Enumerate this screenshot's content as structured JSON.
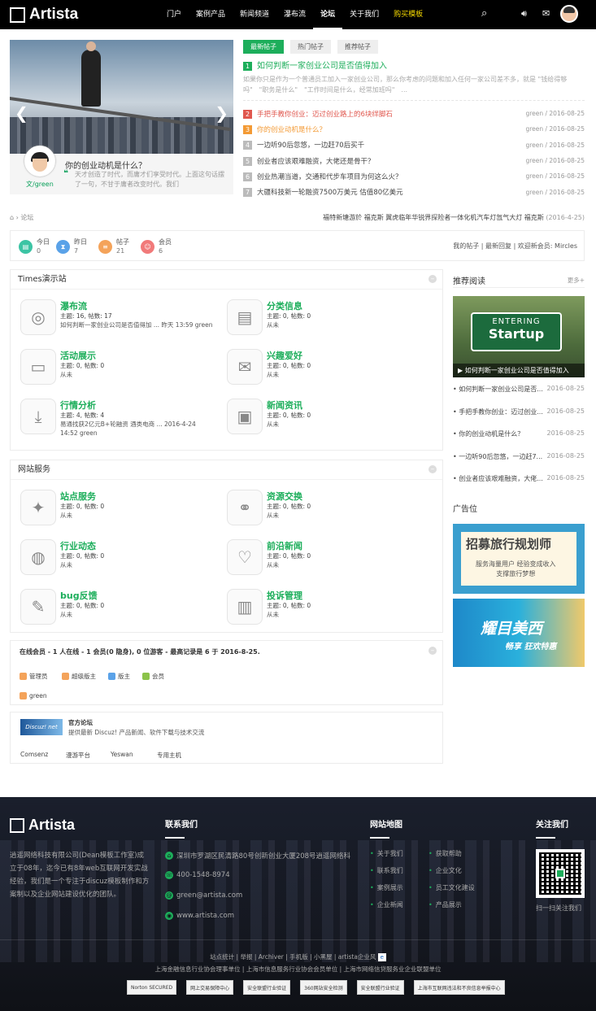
{
  "header": {
    "logo": "Artista",
    "nav": [
      "门户",
      "案例产品",
      "新闻频道",
      "瀑布流",
      "论坛",
      "关于我们",
      "购买模板"
    ],
    "active_nav": "论坛"
  },
  "slider": {
    "title": "你的创业动机是什么？",
    "text": "天才创造了时代，而庸才们享受时代。上面这句话摆了一句，不甘于庸者改变时代。我们",
    "author": "文/green"
  },
  "tabs": [
    "最新帖子",
    "热门帖子",
    "推荐帖子"
  ],
  "featured": {
    "num": "1",
    "title": "如何判断一家创业公司是否值得加入",
    "desc": "如果你只是作为一个普通员工加入一家创业公司，那么你考虑的问题和加入任何一家公司差不多，就是 \"钱给得够吗\"　\"职务是什么\"　\"工作时间是什么，经常加班吗\"　..."
  },
  "posts": [
    {
      "num": "2",
      "title": "手把手教你创业：迈过创业路上的6块绊脚石",
      "meta": "green / 2016-08-25",
      "color": "#e0574e"
    },
    {
      "num": "3",
      "title": "你的创业动机是什么？",
      "meta": "green / 2016-08-25",
      "color": "#f39a35"
    },
    {
      "num": "4",
      "title": "一边听90后忽悠，一边赶70后买千",
      "meta": "green / 2016-08-25",
      "color": "#bbbbbb"
    },
    {
      "num": "5",
      "title": "创业者应该艰难融资，大佬还是骨干？",
      "meta": "green / 2016-08-25",
      "color": "#bbbbbb"
    },
    {
      "num": "6",
      "title": "创业热潮当道，交通和代步车项目为何这么火？",
      "meta": "green / 2016-08-25",
      "color": "#bbbbbb"
    },
    {
      "num": "7",
      "title": "大疆科技新一轮融资7500万美元 估值80亿美元",
      "meta": "green / 2016-08-25",
      "color": "#bbbbbb"
    }
  ],
  "breadcrumb": {
    "home": "论坛",
    "notice": "福特新塘游於 福克斯 翼虎临年华锐界探险者一体化机汽车灯氙气大灯 福克斯",
    "date": "(2016-4-25)"
  },
  "stats": [
    {
      "label": "今日",
      "value": "0",
      "color": "#3cc4a4",
      "icon": "▤"
    },
    {
      "label": "昨日",
      "value": "7",
      "color": "#5aa2e8",
      "icon": "⧗"
    },
    {
      "label": "帖子",
      "value": "21",
      "color": "#f4a35a",
      "icon": "≡"
    },
    {
      "label": "会员",
      "value": "6",
      "color": "#f17a7a",
      "icon": "☺"
    }
  ],
  "stats_right": "我的帖子 | 最新回复 | 欢迎新会员: Mircles",
  "section1": {
    "title": "Times演示站",
    "forums": [
      {
        "name": "瀑布流",
        "stat": "主题: 16, 帖数: 17",
        "last": "如何判断一家创业公司是否值得加 ... 昨天 13:59 green",
        "icon": "◎"
      },
      {
        "name": "分类信息",
        "stat": "主题: 0, 帖数: 0",
        "last": "从未",
        "icon": "▤"
      },
      {
        "name": "活动展示",
        "stat": "主题: 0, 帖数: 0",
        "last": "从未",
        "icon": "▭"
      },
      {
        "name": "兴趣爱好",
        "stat": "主题: 0, 帖数: 0",
        "last": "从未",
        "icon": "✉"
      },
      {
        "name": "行情分析",
        "stat": "主题: 4, 帖数: 4",
        "last": "易通找获2亿元B+轮融资 酒类电商 ... 2016-4-24 14:52 green",
        "icon": "⤓"
      },
      {
        "name": "新闻资讯",
        "stat": "主题: 0, 帖数: 0",
        "last": "从未",
        "icon": "▣"
      }
    ]
  },
  "section2": {
    "title": "网站服务",
    "forums": [
      {
        "name": "站点服务",
        "stat": "主题: 0, 帖数: 0",
        "last": "从未",
        "icon": "✦"
      },
      {
        "name": "资源交换",
        "stat": "主题: 0, 帖数: 0",
        "last": "从未",
        "icon": "⚭"
      },
      {
        "name": "行业动态",
        "stat": "主题: 0, 帖数: 0",
        "last": "从未",
        "icon": "◍"
      },
      {
        "name": "前沿新闻",
        "stat": "主题: 0, 帖数: 0",
        "last": "从未",
        "icon": "♡"
      },
      {
        "name": "bug反馈",
        "stat": "主题: 0, 帖数: 0",
        "last": "从未",
        "icon": "✎"
      },
      {
        "name": "投诉管理",
        "stat": "主题: 0, 帖数: 0",
        "last": "从未",
        "icon": "▥"
      }
    ]
  },
  "online": {
    "title": "在线会员 - 1 人在线 - 1 会员(0 隐身), 0 位游客 - 最高记录是 6 于 2016-8-25.",
    "legend": [
      {
        "label": "管理员",
        "color": "#f4a35a"
      },
      {
        "label": "超级版主",
        "color": "#f4a35a"
      },
      {
        "label": "版主",
        "color": "#5aa2e8"
      },
      {
        "label": "会员",
        "color": "#8bc34a"
      }
    ],
    "user": "green"
  },
  "links": {
    "logo": "Discuz! net",
    "title": "官方论坛",
    "desc": "提供最新 Discuz! 产品新闻、软件下载与技术交流",
    "items": [
      "Comsenz",
      "漫游平台",
      "Yeswan",
      "专用主机"
    ]
  },
  "sidebar": {
    "rec_title": "推荐阅读",
    "more": "更多+",
    "img_sign_top": "ENTERING",
    "img_sign_bottom": "Startup",
    "img_caption": "如何判断一家创业公司是否值得加入",
    "items": [
      {
        "title": "如何判断一家创业公司是否...",
        "date": "2016-08-25"
      },
      {
        "title": "手把手教你创业：迈过创业...",
        "date": "2016-08-25"
      },
      {
        "title": "你的创业动机是什么？",
        "date": "2016-08-25"
      },
      {
        "title": "一边听90后忽悠，一边赶7...",
        "date": "2016-08-25"
      },
      {
        "title": "创业者应该艰难融资，大佬...",
        "date": "2016-08-25"
      }
    ],
    "ad_title": "广告位",
    "ad1_title": "招募旅行规划师",
    "ad1_line1": "服务海量用户 经验变成收入",
    "ad1_line2": "支撑旅行梦想",
    "ad2_title": "耀目美西",
    "ad2_sub": "畅享 狂欢特惠"
  },
  "footer": {
    "logo": "Artista",
    "about": "逍遥网络科技有限公司(Dean模板工作室)成立于08年，迄今已有8年web互联网开发实战经验，我们是一个专注于discuz模板制作和方案制以及企业网站建设优化的团队。",
    "contact_title": "联系我们",
    "contact": [
      {
        "text": "深圳市罗湖区民清路80号创新创业大厦208号逍遥网络科",
        "icon": "⌂"
      },
      {
        "text": "400-1548-8974",
        "icon": "☏"
      },
      {
        "text": "green@artista.com",
        "icon": "@"
      },
      {
        "text": "www.artista.com",
        "icon": "◉"
      }
    ],
    "map_title": "网站地图",
    "map_links": [
      "关于我们",
      "获取帮助",
      "联系我们",
      "企业文化",
      "案例展示",
      "员工文化建设",
      "企业新闻",
      "产品展示"
    ],
    "follow_title": "关注我们",
    "follow_text": "扫一扫关注我们",
    "bottom_links": "站点统计 | 举报 | Archiver | 手机版 | 小黑屋 | artista企业风",
    "bottom_units": "上海金融信息行业协会理事单位 | 上海市信息服务行业协会会员单位 | 上海市网络信贷服务业企业联盟单位",
    "badges": [
      "Norton SECURED",
      "网上交易保障中心",
      "安全联盟行业验证",
      "360网站安全检测",
      "安全联盟行业验证",
      "上海市互联网违法和不良信息举报中心"
    ]
  }
}
